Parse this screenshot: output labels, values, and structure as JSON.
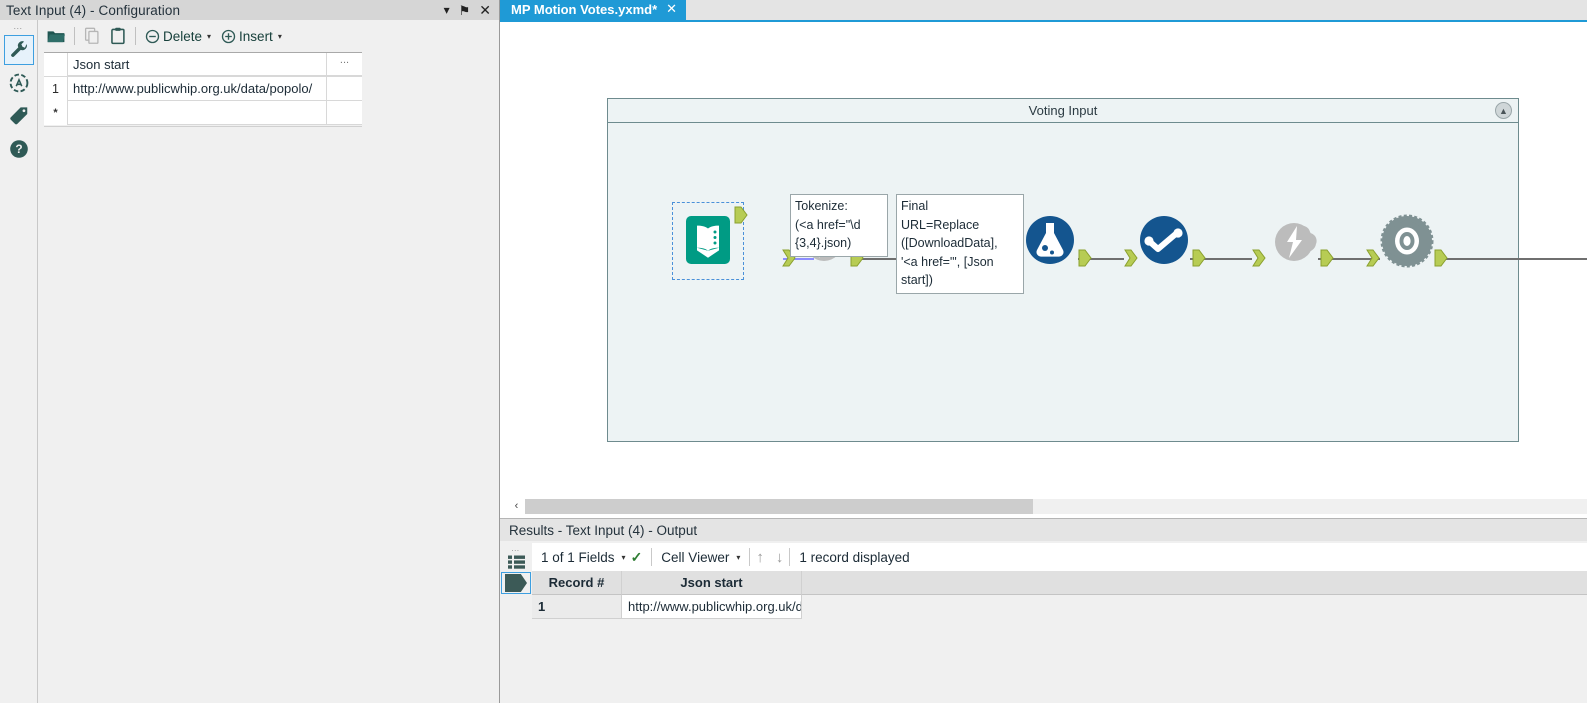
{
  "config_panel": {
    "title": "Text Input (4) - Configuration",
    "titlebar_buttons": [
      {
        "name": "dropdown",
        "glyph": "▾"
      },
      {
        "name": "pin",
        "glyph": "⚑"
      },
      {
        "name": "close",
        "glyph": "✕"
      }
    ],
    "rail_icons": [
      {
        "name": "wrench-icon",
        "selected": true
      },
      {
        "name": "annotation-icon",
        "selected": false
      },
      {
        "name": "tag-icon",
        "selected": false
      },
      {
        "name": "help-icon",
        "selected": false
      }
    ],
    "toolbar": {
      "open_label": "",
      "copy_label": "",
      "paste_label": "",
      "delete_label": "Delete",
      "insert_label": "Insert",
      "caret": "▾"
    },
    "grid": {
      "column_header": "Json start",
      "extra_column_header": "...",
      "rows": [
        {
          "num": "1",
          "value": "http://www.publicwhip.org.uk/data/popolo/"
        }
      ],
      "new_row_marker": "*"
    }
  },
  "tab": {
    "title": "MP Motion Votes.yxmd*",
    "close_glyph": "✕",
    "accent_color": "#1f9ad6"
  },
  "canvas": {
    "container": {
      "title": "Voting Input",
      "collapse_glyph": "▲"
    },
    "tools": [
      {
        "name": "text-input-tool",
        "icon": "book-icon",
        "selected": true
      },
      {
        "name": "download-tool",
        "icon": "cloud-lightning-icon",
        "selected": false
      },
      {
        "name": "regex-tool",
        "icon": "regex-icon",
        "label": "(.*)",
        "selected": false
      },
      {
        "name": "formula-tool",
        "icon": "flask-icon",
        "selected": false
      },
      {
        "name": "filter-tool",
        "icon": "check-chart-icon",
        "selected": false
      },
      {
        "name": "download-tool-2",
        "icon": "cloud-lightning-icon",
        "selected": false
      },
      {
        "name": "json-parse-tool",
        "icon": "gear-target-icon",
        "selected": false
      }
    ],
    "annotations": [
      {
        "name": "tokenize-annotation",
        "text": "Tokenize:\n(<a href=\"\\d\n{3,4}.json)"
      },
      {
        "name": "final-url-annotation",
        "text": "Final\nURL=Replace\n([DownloadData],\n'<a href=\"', [Json\nstart])"
      }
    ],
    "scrollbar": {
      "left_arrow": "‹"
    }
  },
  "results": {
    "title": "Results - Text Input (4) - Output",
    "toolbar": {
      "fields_label": "1 of 1 Fields",
      "fields_caret": "▾",
      "check_glyph": "✓",
      "viewer_label": "Cell Viewer",
      "viewer_caret": "▾",
      "arrow_up": "↑",
      "arrow_down": "↓",
      "record_count": "1 record displayed"
    },
    "columns": [
      "Record #",
      "Json start"
    ],
    "rows": [
      {
        "record": "1",
        "json_start": "http://www.publicwhip.org.uk/data/popolo/"
      }
    ]
  }
}
